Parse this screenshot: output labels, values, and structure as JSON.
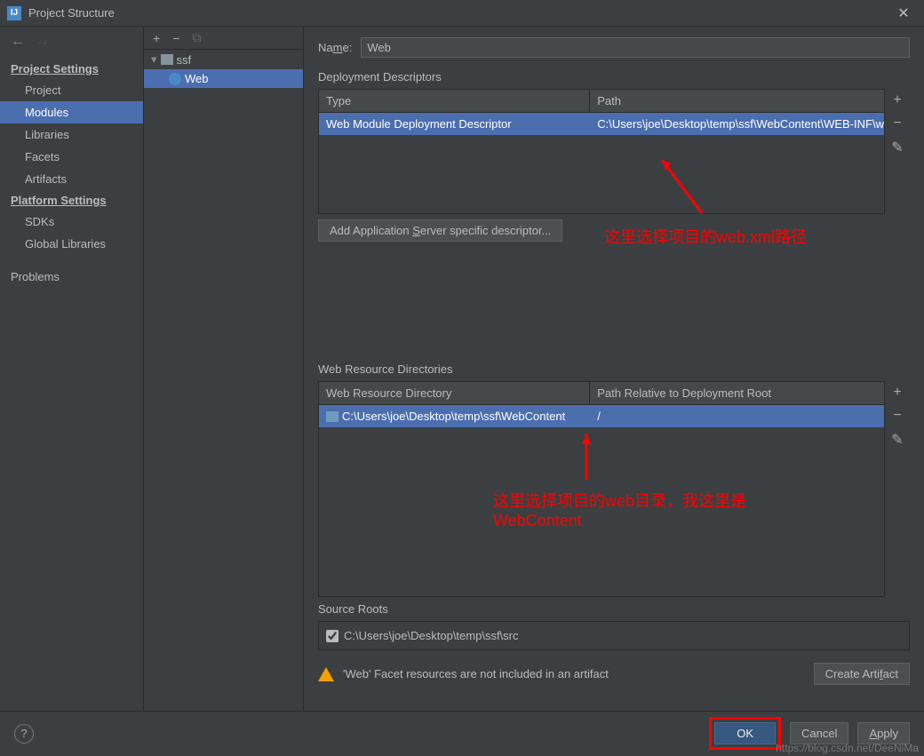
{
  "window": {
    "title": "Project Structure"
  },
  "sidebar": {
    "sections": {
      "project_settings": "Project Settings",
      "platform_settings": "Platform Settings"
    },
    "items": {
      "project": "Project",
      "modules": "Modules",
      "libraries": "Libraries",
      "facets": "Facets",
      "artifacts": "Artifacts",
      "sdks": "SDKs",
      "global_libraries": "Global Libraries",
      "problems": "Problems"
    }
  },
  "tree": {
    "root": "ssf",
    "child": "Web"
  },
  "form": {
    "name_label": "Name:",
    "name_value": "Web"
  },
  "deployment": {
    "title": "Deployment Descriptors",
    "header_type": "Type",
    "header_path": "Path",
    "row_type": "Web Module Deployment Descriptor",
    "row_path": "C:\\Users\\joe\\Desktop\\temp\\ssf\\WebContent\\WEB-INF\\w",
    "add_button": "Add Application Server specific descriptor..."
  },
  "webres": {
    "title": "Web Resource Directories",
    "header_dir": "Web Resource Directory",
    "header_rel": "Path Relative to Deployment Root",
    "row_dir": "C:\\Users\\joe\\Desktop\\temp\\ssf\\WebContent",
    "row_rel": "/"
  },
  "source": {
    "title": "Source Roots",
    "path": "C:\\Users\\joe\\Desktop\\temp\\ssf\\src"
  },
  "warning": {
    "text": "'Web' Facet resources are not included in an artifact",
    "button": "Create Artifact"
  },
  "footer": {
    "ok": "OK",
    "cancel": "Cancel",
    "apply": "Apply"
  },
  "annotations": {
    "a1": "这里选择项目的web.xml路径",
    "a2": "这里选择项目的web目录，我这里是WebContent"
  },
  "watermark": "https://blog.csdn.net/DeeNiMa"
}
